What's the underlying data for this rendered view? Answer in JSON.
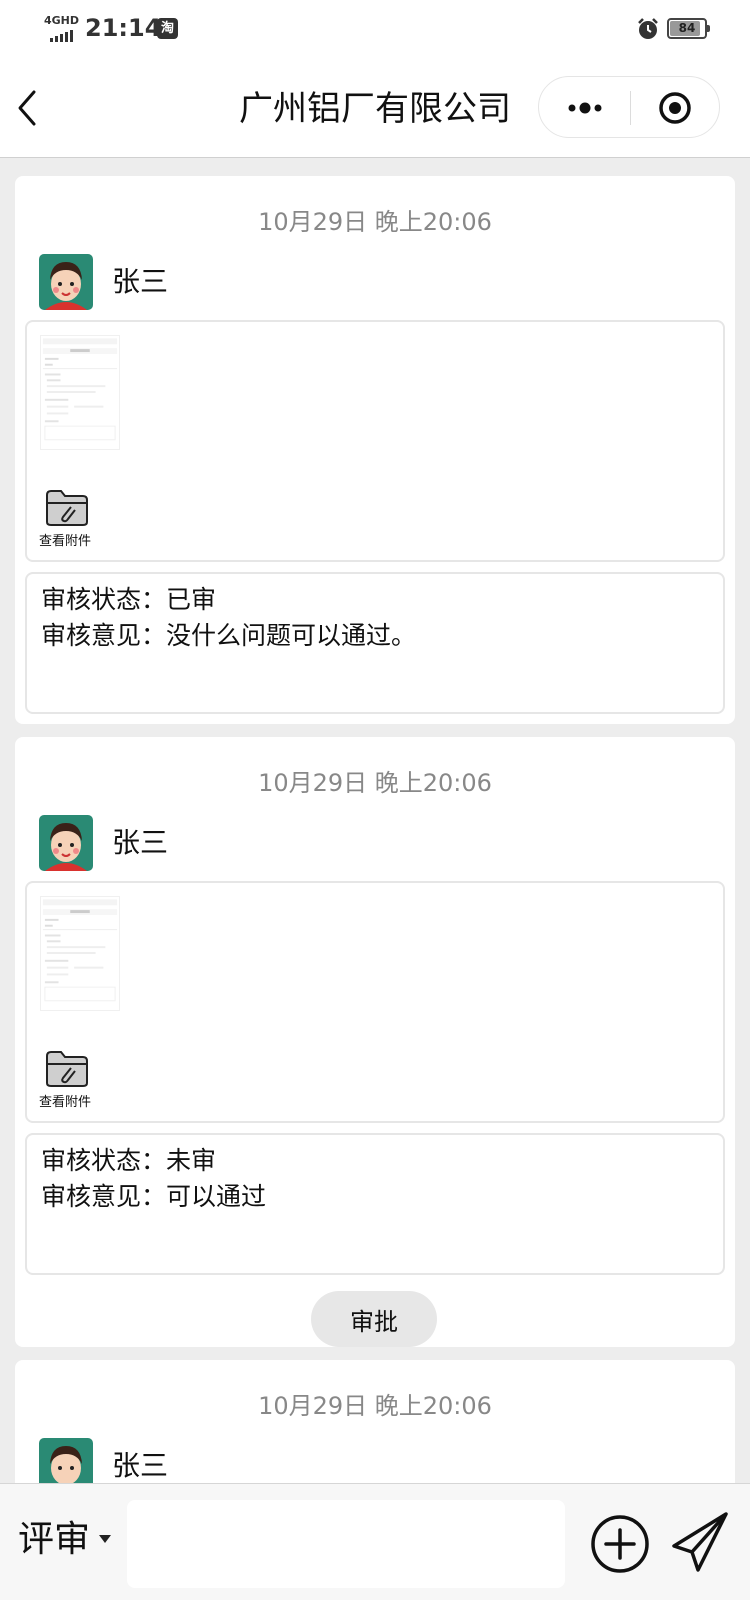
{
  "status_bar": {
    "network": "4GHD",
    "time": "21:14",
    "app_badge": "淘",
    "battery": "84",
    "battery_level": 0.84
  },
  "nav": {
    "title": "广州铝厂有限公司",
    "back_icon": "chevron-left-icon",
    "more_icon": "more-dots-icon",
    "close_icon": "target-close-icon"
  },
  "records": [
    {
      "time": "10月29日 晚上20:06",
      "user": "张三",
      "attachment_label": "查看附件",
      "status_line": "审核状态：已审",
      "opinion_line": "审核意见：没什么问题可以通过。"
    },
    {
      "time": "10月29日 晚上20:06",
      "user": "张三",
      "attachment_label": "查看附件",
      "status_line": "审核状态：未审",
      "opinion_line": "审核意见：可以通过",
      "action_label": "审批"
    },
    {
      "time": "10月29日 晚上20:06",
      "user": "张三"
    }
  ],
  "input_bar": {
    "mode_label": "评审",
    "input_value": "",
    "add_icon": "plus-circle-icon",
    "send_icon": "send-plane-icon"
  }
}
